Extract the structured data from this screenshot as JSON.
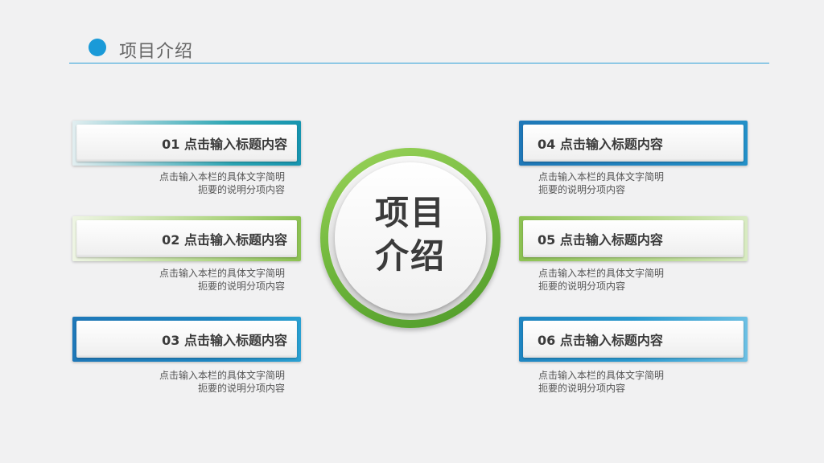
{
  "header": {
    "title": "项目介绍"
  },
  "center": {
    "line1": "项目",
    "line2": "介绍"
  },
  "items": [
    {
      "title": "01 点击输入标题内容",
      "desc1": "点击输入本栏的具体文字简明",
      "desc2": "扼要的说明分项内容"
    },
    {
      "title": "02 点击输入标题内容",
      "desc1": "点击输入本栏的具体文字简明",
      "desc2": "扼要的说明分项内容"
    },
    {
      "title": "03 点击输入标题内容",
      "desc1": "点击输入本栏的具体文字简明",
      "desc2": "扼要的说明分项内容"
    },
    {
      "title": "04 点击输入标题内容",
      "desc1": "点击输入本栏的具体文字简明",
      "desc2": "扼要的说明分项内容"
    },
    {
      "title": "05 点击输入标题内容",
      "desc1": "点击输入本栏的具体文字简明",
      "desc2": "扼要的说明分项内容"
    },
    {
      "title": "06 点击输入标题内容",
      "desc1": "点击输入本栏的具体文字简明",
      "desc2": "扼要的说明分项内容"
    }
  ],
  "colors": {
    "accent_blue": "#1a9ad8",
    "accent_green": "#6cb43a",
    "teal": "#2aa5b4"
  }
}
